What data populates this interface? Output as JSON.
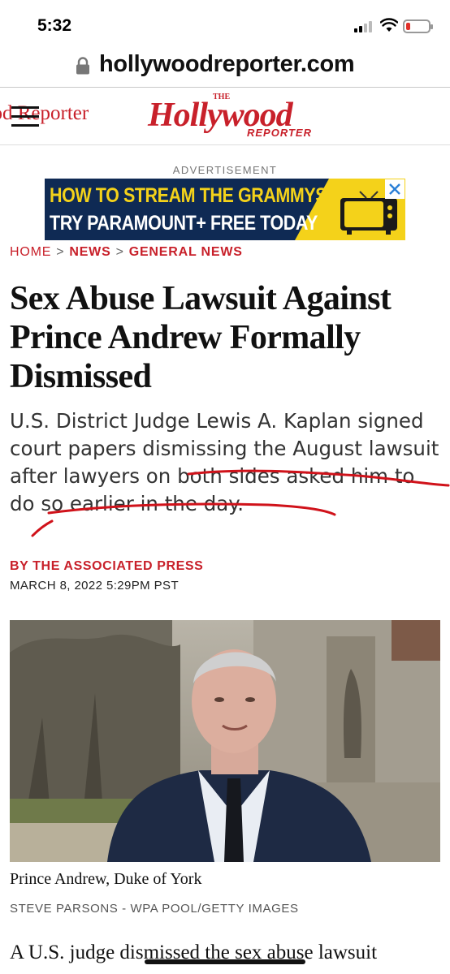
{
  "status_bar": {
    "time": "5:32"
  },
  "browser": {
    "url": "hollywoodreporter.com"
  },
  "site_header": {
    "left_text": "ood Reporter",
    "logo_the": "THE",
    "logo_main": "Hollywood",
    "logo_reporter": "REPORTER"
  },
  "ad": {
    "label": "ADVERTISEMENT",
    "line1": "HOW TO STREAM THE GRAMMYS",
    "line2": "TRY PARAMOUNT+ FREE TODAY"
  },
  "breadcrumb": {
    "home": "HOME",
    "news": "NEWS",
    "general": "GENERAL NEWS",
    "separator": ">"
  },
  "article": {
    "headline": "Sex Abuse Lawsuit Against Prince Andrew Formally Dismissed",
    "dek": "U.S. District Judge Lewis A. Kaplan signed court papers dismissing the August lawsuit after lawyers on both sides asked him to do so earlier in the day.",
    "byline": "BY THE ASSOCIATED PRESS",
    "date": "MARCH 8, 2022 5:29PM PST",
    "photo_caption": "Prince Andrew, Duke of York",
    "photo_credit": "STEVE PARSONS - WPA POOL/GETTY IMAGES",
    "body_start": "A U.S. judge dismissed the sex abuse lawsuit"
  },
  "colors": {
    "brand_red": "#c8202a",
    "ad_navy": "#0f2a54",
    "ad_yellow": "#f4d21a",
    "annotation_red": "#d0121a"
  },
  "icons": [
    "signal-icon",
    "wifi-icon",
    "battery-icon",
    "lock-icon",
    "menu-icon",
    "tv-icon",
    "close-icon"
  ]
}
